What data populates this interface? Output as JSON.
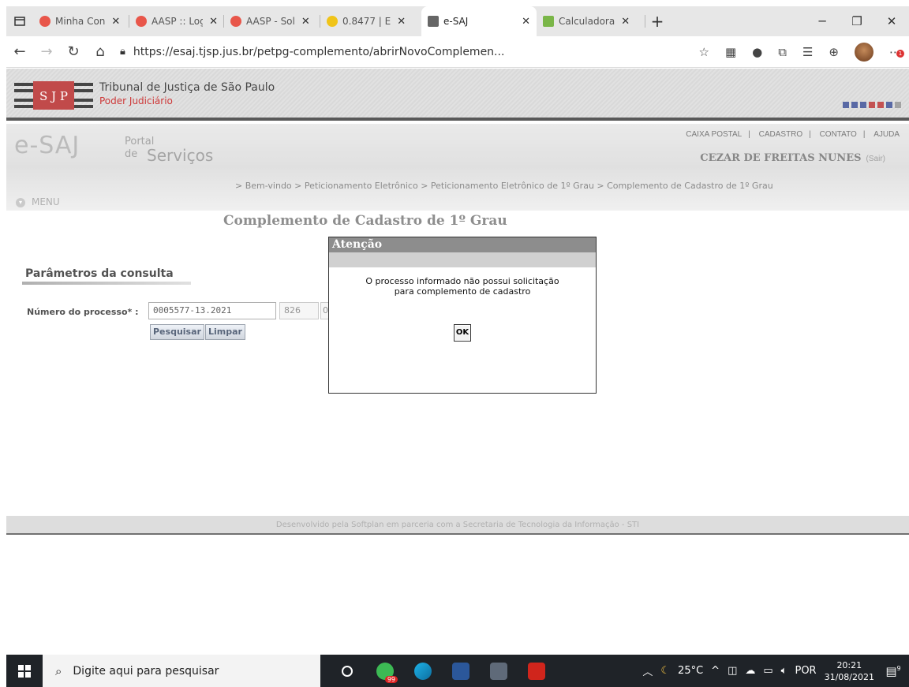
{
  "browser": {
    "tabs": [
      {
        "title": "Minha Con",
        "color": "#e8564a",
        "active": false
      },
      {
        "title": "AASP :: Log",
        "color": "#e8564a",
        "active": false
      },
      {
        "title": "AASP - Sol",
        "color": "#e8564a",
        "active": false
      },
      {
        "title": "0.8477 | E",
        "color": "#f0c419",
        "active": false
      },
      {
        "title": "e-SAJ",
        "color": "#666666",
        "active": true
      },
      {
        "title": "Calculadora",
        "color": "#7ab648",
        "active": false
      }
    ],
    "close_glyph": "✕",
    "new_tab_glyph": "+",
    "url": "https://esaj.tjsp.jus.br/petpg-complemento/abrirNovoComplemen...",
    "notif_badge": "1"
  },
  "header": {
    "court_name": "Tribunal de Justiça de São Paulo",
    "subtitle": "Poder Judiciário",
    "square_colors": [
      "#2b3f8c",
      "#2b3f8c",
      "#2b3f8c",
      "#b22222",
      "#b22222",
      "#2b3f8c",
      "#8a8a8a"
    ]
  },
  "esaj": {
    "logo": "e-SAJ",
    "portal_top": "Portal",
    "portal_de": "de",
    "portal_bottom": "Serviços",
    "links": [
      "CAIXA POSTAL",
      "CADASTRO",
      "CONTATO",
      "AJUDA"
    ],
    "link_sep": "|",
    "user": "CEZAR DE FREITAS NUNES",
    "logout": "(Sair)",
    "breadcrumb": "> Bem-vindo > Peticionamento Eletrônico > Peticionamento Eletrônico de 1º Grau > Complemento de Cadastro de 1º Grau",
    "menu": "MENU"
  },
  "main": {
    "title": "Complemento de Cadastro de 1º Grau",
    "section": "Parâmetros da consulta",
    "field_label": "Número do processo*  :",
    "process_number": "0005577-13.2021",
    "segment": "826",
    "foro": "0",
    "search_btn": "Pesquisar",
    "clear_btn": "Limpar"
  },
  "footer": "Desenvolvido pela Softplan em parceria com a Secretaria de Tecnologia da Informação - STI",
  "dialog": {
    "title": "Atenção",
    "message_line1": "O processo informado não possui solicitação",
    "message_line2": "para complemento de cadastro",
    "ok": "OK"
  },
  "taskbar": {
    "search_placeholder": "Digite aqui para pesquisar",
    "whatsapp_badge": "99",
    "temperature": "25°C",
    "language": "POR",
    "time": "20:21",
    "date": "31/08/2021",
    "notif_count": "9"
  }
}
